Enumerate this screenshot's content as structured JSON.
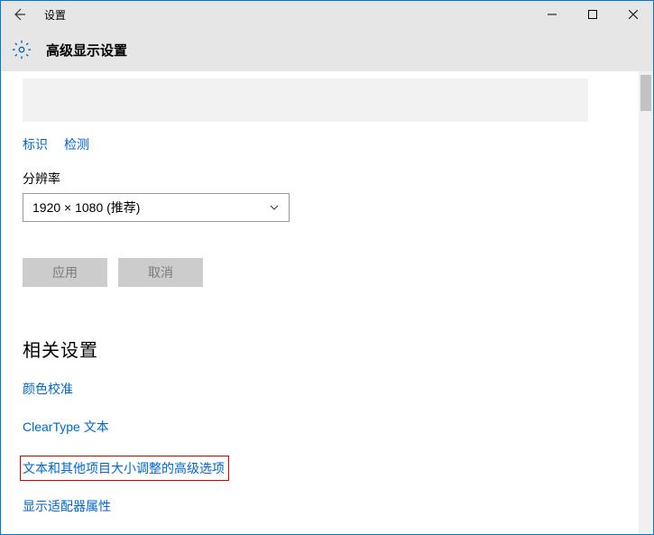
{
  "titlebar": {
    "title": "设置"
  },
  "header": {
    "title": "高级显示设置"
  },
  "actions": {
    "identify": "标识",
    "detect": "检测"
  },
  "resolution": {
    "label": "分辨率",
    "value": "1920 × 1080 (推荐)"
  },
  "buttons": {
    "apply": "应用",
    "cancel": "取消"
  },
  "related": {
    "heading": "相关设置",
    "links": {
      "color_calibration": "颜色校准",
      "cleartype": "ClearType 文本",
      "advanced_sizing": "文本和其他项目大小调整的高级选项",
      "adapter_properties": "显示适配器属性"
    }
  }
}
